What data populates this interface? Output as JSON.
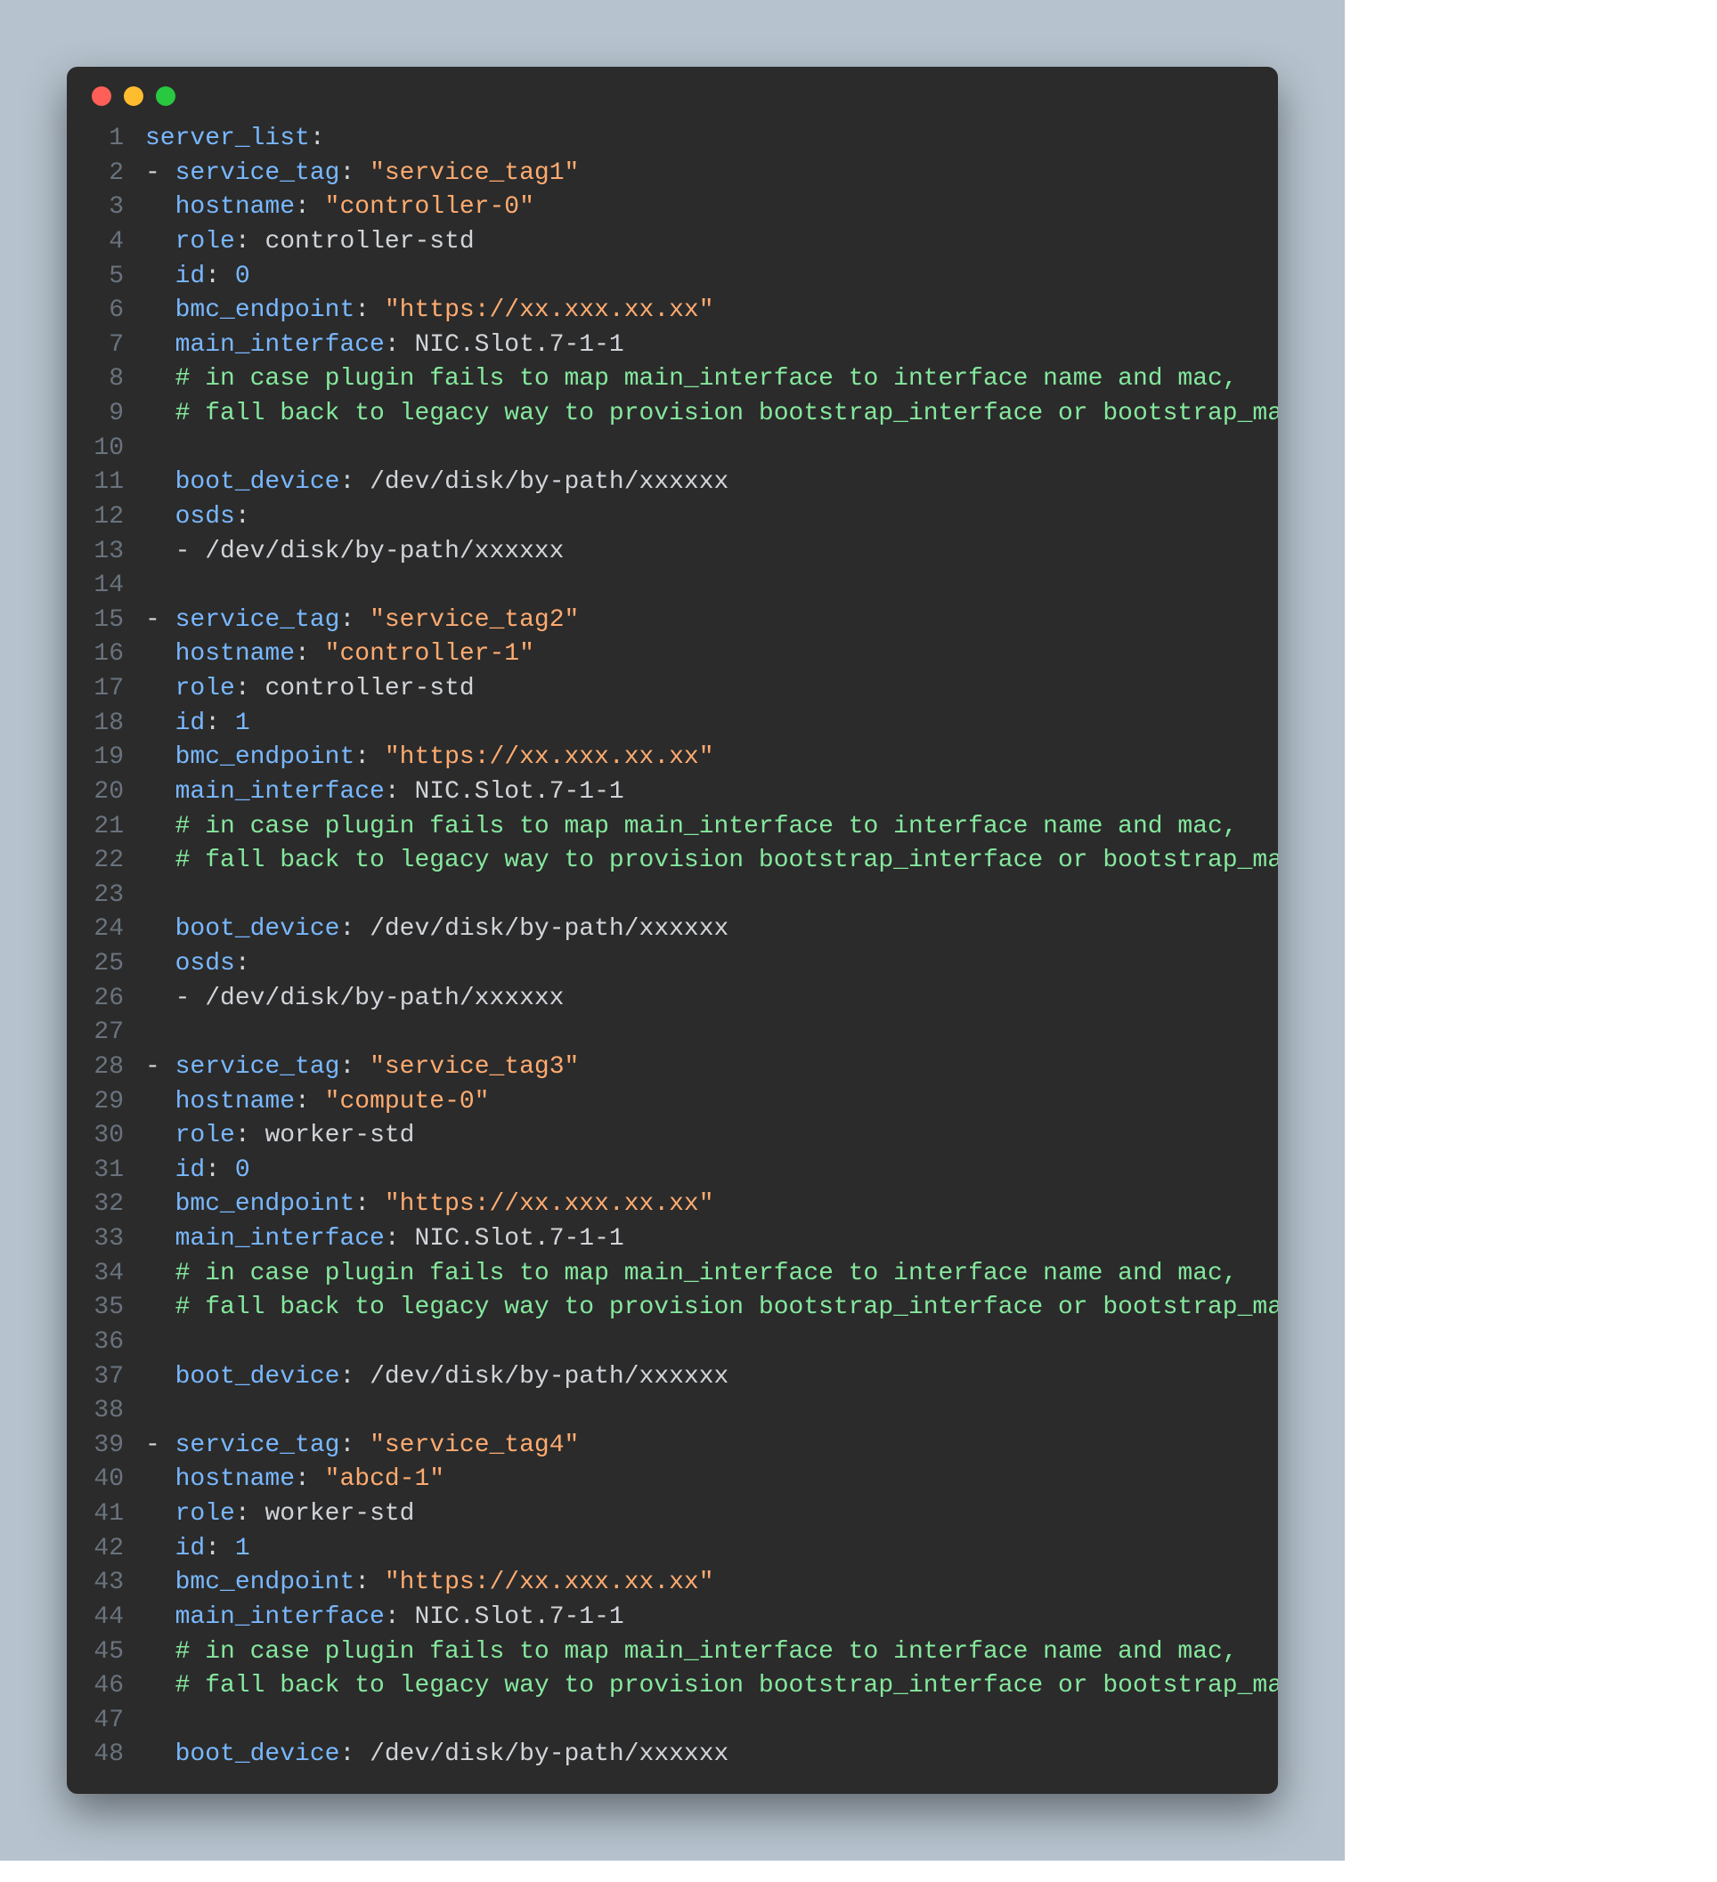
{
  "code": {
    "language": "yaml",
    "lines": [
      {
        "n": 1,
        "t": [
          [
            "key",
            "server_list"
          ],
          [
            "punc",
            ":"
          ]
        ]
      },
      {
        "n": 2,
        "t": [
          [
            "dash",
            "- "
          ],
          [
            "key",
            "service_tag"
          ],
          [
            "punc",
            ":"
          ],
          [
            "val",
            " "
          ],
          [
            "str",
            "\"service_tag1\""
          ]
        ]
      },
      {
        "n": 3,
        "t": [
          [
            "val",
            "  "
          ],
          [
            "key",
            "hostname"
          ],
          [
            "punc",
            ":"
          ],
          [
            "val",
            " "
          ],
          [
            "str",
            "\"controller-0\""
          ]
        ]
      },
      {
        "n": 4,
        "t": [
          [
            "val",
            "  "
          ],
          [
            "key",
            "role"
          ],
          [
            "punc",
            ":"
          ],
          [
            "val",
            " controller-std"
          ]
        ]
      },
      {
        "n": 5,
        "t": [
          [
            "val",
            "  "
          ],
          [
            "key",
            "id"
          ],
          [
            "punc",
            ":"
          ],
          [
            "val",
            " "
          ],
          [
            "num",
            "0"
          ]
        ]
      },
      {
        "n": 6,
        "t": [
          [
            "val",
            "  "
          ],
          [
            "key",
            "bmc_endpoint"
          ],
          [
            "punc",
            ":"
          ],
          [
            "val",
            " "
          ],
          [
            "str",
            "\"https://xx.xxx.xx.xx\""
          ]
        ]
      },
      {
        "n": 7,
        "t": [
          [
            "val",
            "  "
          ],
          [
            "key",
            "main_interface"
          ],
          [
            "punc",
            ":"
          ],
          [
            "val",
            " NIC.Slot.7-1-1"
          ]
        ]
      },
      {
        "n": 8,
        "t": [
          [
            "val",
            "  "
          ],
          [
            "comment",
            "# in case plugin fails to map main_interface to interface name and mac,"
          ]
        ]
      },
      {
        "n": 9,
        "t": [
          [
            "val",
            "  "
          ],
          [
            "comment",
            "# fall back to legacy way to provision bootstrap_interface or bootstrap_mac"
          ]
        ]
      },
      {
        "n": 10,
        "t": []
      },
      {
        "n": 11,
        "t": [
          [
            "val",
            "  "
          ],
          [
            "key",
            "boot_device"
          ],
          [
            "punc",
            ":"
          ],
          [
            "val",
            " /dev/disk/by-path/xxxxxx"
          ]
        ]
      },
      {
        "n": 12,
        "t": [
          [
            "val",
            "  "
          ],
          [
            "key",
            "osds"
          ],
          [
            "punc",
            ":"
          ]
        ]
      },
      {
        "n": 13,
        "t": [
          [
            "val",
            "  "
          ],
          [
            "dash",
            "- "
          ],
          [
            "val",
            "/dev/disk/by-path/xxxxxx"
          ]
        ]
      },
      {
        "n": 14,
        "t": []
      },
      {
        "n": 15,
        "t": [
          [
            "dash",
            "- "
          ],
          [
            "key",
            "service_tag"
          ],
          [
            "punc",
            ":"
          ],
          [
            "val",
            " "
          ],
          [
            "str",
            "\"service_tag2\""
          ]
        ]
      },
      {
        "n": 16,
        "t": [
          [
            "val",
            "  "
          ],
          [
            "key",
            "hostname"
          ],
          [
            "punc",
            ":"
          ],
          [
            "val",
            " "
          ],
          [
            "str",
            "\"controller-1\""
          ]
        ]
      },
      {
        "n": 17,
        "t": [
          [
            "val",
            "  "
          ],
          [
            "key",
            "role"
          ],
          [
            "punc",
            ":"
          ],
          [
            "val",
            " controller-std"
          ]
        ]
      },
      {
        "n": 18,
        "t": [
          [
            "val",
            "  "
          ],
          [
            "key",
            "id"
          ],
          [
            "punc",
            ":"
          ],
          [
            "val",
            " "
          ],
          [
            "num",
            "1"
          ]
        ]
      },
      {
        "n": 19,
        "t": [
          [
            "val",
            "  "
          ],
          [
            "key",
            "bmc_endpoint"
          ],
          [
            "punc",
            ":"
          ],
          [
            "val",
            " "
          ],
          [
            "str",
            "\"https://xx.xxx.xx.xx\""
          ]
        ]
      },
      {
        "n": 20,
        "t": [
          [
            "val",
            "  "
          ],
          [
            "key",
            "main_interface"
          ],
          [
            "punc",
            ":"
          ],
          [
            "val",
            " NIC.Slot.7-1-1"
          ]
        ]
      },
      {
        "n": 21,
        "t": [
          [
            "val",
            "  "
          ],
          [
            "comment",
            "# in case plugin fails to map main_interface to interface name and mac,"
          ]
        ]
      },
      {
        "n": 22,
        "t": [
          [
            "val",
            "  "
          ],
          [
            "comment",
            "# fall back to legacy way to provision bootstrap_interface or bootstrap_mac"
          ]
        ]
      },
      {
        "n": 23,
        "t": []
      },
      {
        "n": 24,
        "t": [
          [
            "val",
            "  "
          ],
          [
            "key",
            "boot_device"
          ],
          [
            "punc",
            ":"
          ],
          [
            "val",
            " /dev/disk/by-path/xxxxxx"
          ]
        ]
      },
      {
        "n": 25,
        "t": [
          [
            "val",
            "  "
          ],
          [
            "key",
            "osds"
          ],
          [
            "punc",
            ":"
          ]
        ]
      },
      {
        "n": 26,
        "t": [
          [
            "val",
            "  "
          ],
          [
            "dash",
            "- "
          ],
          [
            "val",
            "/dev/disk/by-path/xxxxxx"
          ]
        ]
      },
      {
        "n": 27,
        "t": []
      },
      {
        "n": 28,
        "t": [
          [
            "dash",
            "- "
          ],
          [
            "key",
            "service_tag"
          ],
          [
            "punc",
            ":"
          ],
          [
            "val",
            " "
          ],
          [
            "str",
            "\"service_tag3\""
          ]
        ]
      },
      {
        "n": 29,
        "t": [
          [
            "val",
            "  "
          ],
          [
            "key",
            "hostname"
          ],
          [
            "punc",
            ":"
          ],
          [
            "val",
            " "
          ],
          [
            "str",
            "\"compute-0\""
          ]
        ]
      },
      {
        "n": 30,
        "t": [
          [
            "val",
            "  "
          ],
          [
            "key",
            "role"
          ],
          [
            "punc",
            ":"
          ],
          [
            "val",
            " worker-std"
          ]
        ]
      },
      {
        "n": 31,
        "t": [
          [
            "val",
            "  "
          ],
          [
            "key",
            "id"
          ],
          [
            "punc",
            ":"
          ],
          [
            "val",
            " "
          ],
          [
            "num",
            "0"
          ]
        ]
      },
      {
        "n": 32,
        "t": [
          [
            "val",
            "  "
          ],
          [
            "key",
            "bmc_endpoint"
          ],
          [
            "punc",
            ":"
          ],
          [
            "val",
            " "
          ],
          [
            "str",
            "\"https://xx.xxx.xx.xx\""
          ]
        ]
      },
      {
        "n": 33,
        "t": [
          [
            "val",
            "  "
          ],
          [
            "key",
            "main_interface"
          ],
          [
            "punc",
            ":"
          ],
          [
            "val",
            " NIC.Slot.7-1-1"
          ]
        ]
      },
      {
        "n": 34,
        "t": [
          [
            "val",
            "  "
          ],
          [
            "comment",
            "# in case plugin fails to map main_interface to interface name and mac,"
          ]
        ]
      },
      {
        "n": 35,
        "t": [
          [
            "val",
            "  "
          ],
          [
            "comment",
            "# fall back to legacy way to provision bootstrap_interface or bootstrap_mac"
          ]
        ]
      },
      {
        "n": 36,
        "t": []
      },
      {
        "n": 37,
        "t": [
          [
            "val",
            "  "
          ],
          [
            "key",
            "boot_device"
          ],
          [
            "punc",
            ":"
          ],
          [
            "val",
            " /dev/disk/by-path/xxxxxx"
          ]
        ]
      },
      {
        "n": 38,
        "t": []
      },
      {
        "n": 39,
        "t": [
          [
            "dash",
            "- "
          ],
          [
            "key",
            "service_tag"
          ],
          [
            "punc",
            ":"
          ],
          [
            "val",
            " "
          ],
          [
            "str",
            "\"service_tag4\""
          ]
        ]
      },
      {
        "n": 40,
        "t": [
          [
            "val",
            "  "
          ],
          [
            "key",
            "hostname"
          ],
          [
            "punc",
            ":"
          ],
          [
            "val",
            " "
          ],
          [
            "str",
            "\"abcd-1\""
          ]
        ]
      },
      {
        "n": 41,
        "t": [
          [
            "val",
            "  "
          ],
          [
            "key",
            "role"
          ],
          [
            "punc",
            ":"
          ],
          [
            "val",
            " worker-std"
          ]
        ]
      },
      {
        "n": 42,
        "t": [
          [
            "val",
            "  "
          ],
          [
            "key",
            "id"
          ],
          [
            "punc",
            ":"
          ],
          [
            "val",
            " "
          ],
          [
            "num",
            "1"
          ]
        ]
      },
      {
        "n": 43,
        "t": [
          [
            "val",
            "  "
          ],
          [
            "key",
            "bmc_endpoint"
          ],
          [
            "punc",
            ":"
          ],
          [
            "val",
            " "
          ],
          [
            "str",
            "\"https://xx.xxx.xx.xx\""
          ]
        ]
      },
      {
        "n": 44,
        "t": [
          [
            "val",
            "  "
          ],
          [
            "key",
            "main_interface"
          ],
          [
            "punc",
            ":"
          ],
          [
            "val",
            " NIC.Slot.7-1-1"
          ]
        ]
      },
      {
        "n": 45,
        "t": [
          [
            "val",
            "  "
          ],
          [
            "comment",
            "# in case plugin fails to map main_interface to interface name and mac,"
          ]
        ]
      },
      {
        "n": 46,
        "t": [
          [
            "val",
            "  "
          ],
          [
            "comment",
            "# fall back to legacy way to provision bootstrap_interface or bootstrap_mac"
          ]
        ]
      },
      {
        "n": 47,
        "t": []
      },
      {
        "n": 48,
        "t": [
          [
            "val",
            "  "
          ],
          [
            "key",
            "boot_device"
          ],
          [
            "punc",
            ":"
          ],
          [
            "val",
            " /dev/disk/by-path/xxxxxx"
          ]
        ]
      }
    ]
  }
}
